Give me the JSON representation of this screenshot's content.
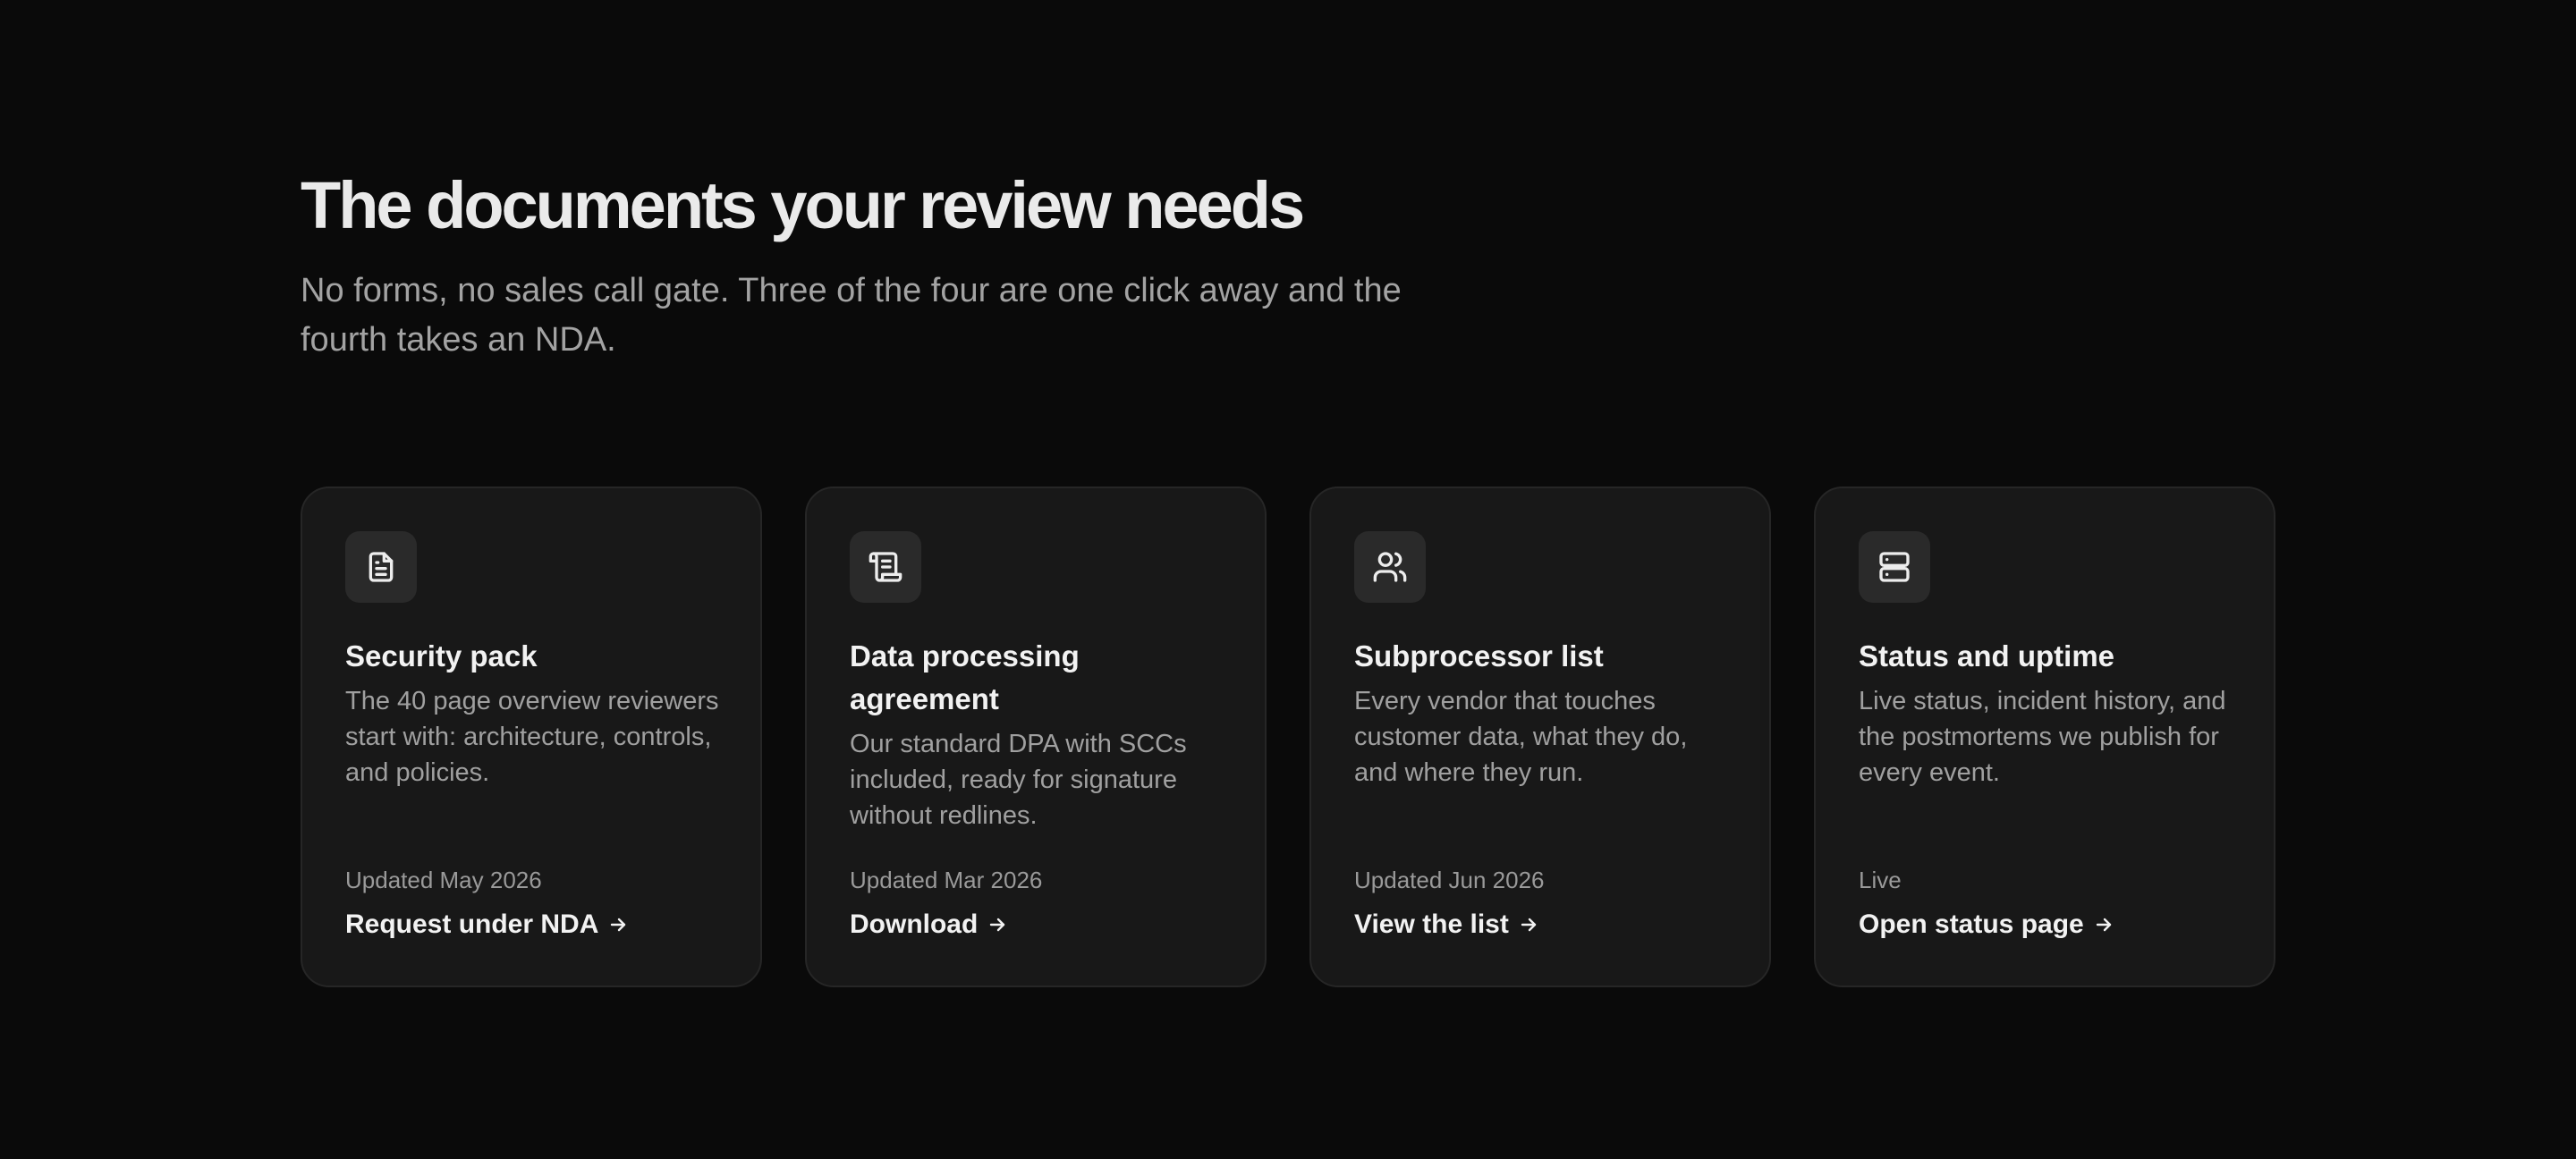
{
  "header": {
    "title": "The documents your review needs",
    "subtitle": "No forms, no sales call gate. Three of the four are one click away and the fourth takes an NDA."
  },
  "cards": [
    {
      "icon": "document-icon",
      "title": "Security pack",
      "description": "The 40 page overview reviewers start with: architecture, controls, and policies.",
      "meta": "Updated May 2026",
      "link": "Request under NDA"
    },
    {
      "icon": "scroll-icon",
      "title": "Data processing agreement",
      "description": "Our standard DPA with SCCs included, ready for signature without redlines.",
      "meta": "Updated Mar 2026",
      "link": "Download"
    },
    {
      "icon": "users-icon",
      "title": "Subprocessor list",
      "description": "Every vendor that touches customer data, what they do, and where they run.",
      "meta": "Updated Jun 2026",
      "link": "View the list"
    },
    {
      "icon": "server-icon",
      "title": "Status and uptime",
      "description": "Live status, incident history, and the postmortems we publish for every event.",
      "meta": "Live",
      "link": "Open status page"
    }
  ],
  "colors": {
    "background": "#0a0a0a",
    "card_background": "#181818",
    "card_border": "#262626",
    "icon_background": "#2a2a2a",
    "heading": "#eaeaea",
    "body_text": "#a0a0a0"
  }
}
